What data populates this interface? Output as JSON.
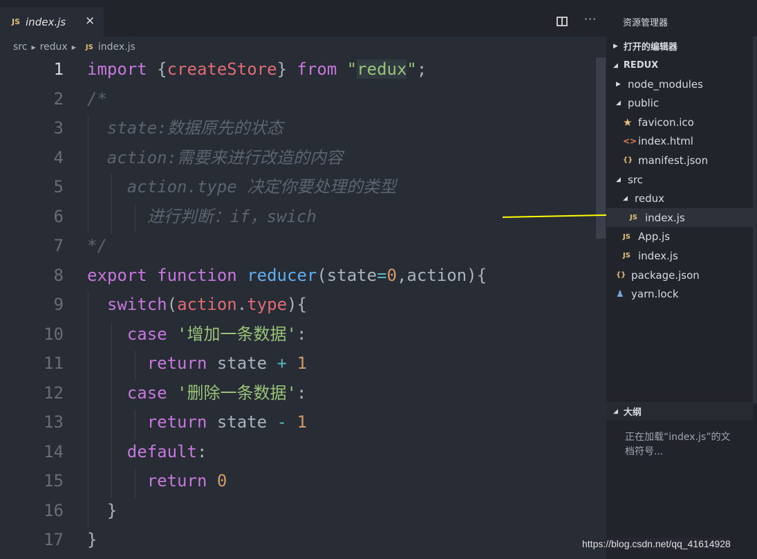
{
  "tab": {
    "icon_text": "JS",
    "label": "index.js",
    "close": "×"
  },
  "toolbar": {
    "more": "···"
  },
  "breadcrumb": {
    "parts": [
      "src",
      "redux"
    ],
    "file_icon": "JS",
    "file": "index.js"
  },
  "editor": {
    "line_numbers": [
      "1",
      "2",
      "3",
      "4",
      "5",
      "6",
      "7",
      "8",
      "9",
      "10",
      "11",
      "12",
      "13",
      "14",
      "15",
      "16",
      "17"
    ],
    "active_line": 1,
    "lines": [
      [
        {
          "t": "import",
          "c": "kw"
        },
        {
          "t": " ",
          "c": ""
        },
        {
          "t": "{",
          "c": ""
        },
        {
          "t": "createStore",
          "c": "red"
        },
        {
          "t": "}",
          "c": ""
        },
        {
          "t": " ",
          "c": ""
        },
        {
          "t": "from",
          "c": "kw"
        },
        {
          "t": " ",
          "c": ""
        },
        {
          "t": "\"",
          "c": "str"
        },
        {
          "t": "redux",
          "c": "str strhl"
        },
        {
          "t": "\"",
          "c": "str"
        },
        {
          "t": ";",
          "c": ""
        }
      ],
      [
        {
          "t": "/*",
          "c": "cm"
        }
      ],
      [
        {
          "t": "  state:数据原先的状态",
          "c": "cm"
        }
      ],
      [
        {
          "t": "  action:需要来进行改造的内容",
          "c": "cm"
        }
      ],
      [
        {
          "t": "    action.type 决定你要处理的类型",
          "c": "cm"
        }
      ],
      [
        {
          "t": "      进行判断：if，swich",
          "c": "cm"
        }
      ],
      [
        {
          "t": "*/",
          "c": "cm"
        }
      ],
      [
        {
          "t": "export",
          "c": "kw"
        },
        {
          "t": " ",
          "c": ""
        },
        {
          "t": "function",
          "c": "kw"
        },
        {
          "t": " ",
          "c": ""
        },
        {
          "t": "reducer",
          "c": "fn"
        },
        {
          "t": "(state",
          "c": ""
        },
        {
          "t": "=",
          "c": "op"
        },
        {
          "t": "0",
          "c": "num"
        },
        {
          "t": ",action){",
          "c": ""
        }
      ],
      [
        {
          "t": "  ",
          "c": ""
        },
        {
          "t": "switch",
          "c": "kw"
        },
        {
          "t": "(",
          "c": ""
        },
        {
          "t": "action",
          "c": "red"
        },
        {
          "t": ".",
          "c": ""
        },
        {
          "t": "type",
          "c": "red"
        },
        {
          "t": "){",
          "c": ""
        }
      ],
      [
        {
          "t": "    ",
          "c": ""
        },
        {
          "t": "case",
          "c": "kw"
        },
        {
          "t": " ",
          "c": ""
        },
        {
          "t": "'增加一条数据'",
          "c": "str"
        },
        {
          "t": ":",
          "c": ""
        }
      ],
      [
        {
          "t": "      ",
          "c": ""
        },
        {
          "t": "return",
          "c": "kw"
        },
        {
          "t": " state ",
          "c": ""
        },
        {
          "t": "+",
          "c": "op"
        },
        {
          "t": " ",
          "c": ""
        },
        {
          "t": "1",
          "c": "num"
        }
      ],
      [
        {
          "t": "    ",
          "c": ""
        },
        {
          "t": "case",
          "c": "kw"
        },
        {
          "t": " ",
          "c": ""
        },
        {
          "t": "'删除一条数据'",
          "c": "str"
        },
        {
          "t": ":",
          "c": ""
        }
      ],
      [
        {
          "t": "      ",
          "c": ""
        },
        {
          "t": "return",
          "c": "kw"
        },
        {
          "t": " state ",
          "c": ""
        },
        {
          "t": "-",
          "c": "op"
        },
        {
          "t": " ",
          "c": ""
        },
        {
          "t": "1",
          "c": "num"
        }
      ],
      [
        {
          "t": "    ",
          "c": ""
        },
        {
          "t": "default",
          "c": "kw"
        },
        {
          "t": ":",
          "c": ""
        }
      ],
      [
        {
          "t": "      ",
          "c": ""
        },
        {
          "t": "return",
          "c": "kw"
        },
        {
          "t": " ",
          "c": ""
        },
        {
          "t": "0",
          "c": "num"
        }
      ],
      [
        {
          "t": "  }",
          "c": ""
        }
      ],
      [
        {
          "t": "}",
          "c": ""
        }
      ]
    ]
  },
  "sidebar": {
    "title": "资源管理器",
    "open_editors": "打开的编辑器",
    "project": "REDUX",
    "outline": "大纲",
    "outline_message": "正在加载“index.js”的文档符号...",
    "tree": [
      {
        "label": "node_modules",
        "icon": "",
        "icon_type": "folder",
        "state": "collapsed"
      },
      {
        "label": "public",
        "icon": "",
        "icon_type": "folder",
        "state": "expanded"
      },
      {
        "label": "favicon.ico",
        "icon": "★",
        "icon_type": "star"
      },
      {
        "label": "index.html",
        "icon": "<>",
        "icon_type": "html"
      },
      {
        "label": "manifest.json",
        "icon": "{}",
        "icon_type": "json"
      },
      {
        "label": "src",
        "icon": "",
        "icon_type": "folder",
        "state": "expanded"
      },
      {
        "label": "redux",
        "icon": "",
        "icon_type": "folder",
        "state": "expanded"
      },
      {
        "label": "index.js",
        "icon": "JS",
        "icon_type": "js",
        "selected": true
      },
      {
        "label": "App.js",
        "icon": "JS",
        "icon_type": "js"
      },
      {
        "label": "index.js",
        "icon": "JS",
        "icon_type": "js"
      },
      {
        "label": "package.json",
        "icon": "{}",
        "icon_type": "json"
      },
      {
        "label": "yarn.lock",
        "icon": "♟",
        "icon_type": "yarn"
      }
    ]
  },
  "watermark": "https://blog.csdn.net/qq_41614928",
  "colors": {
    "editor_bg": "#282c34",
    "sidebar_bg": "#21252b",
    "keyword": "#c678dd",
    "string": "#98c379",
    "function": "#61afef",
    "number": "#d19a66",
    "arrow": "#ffff00"
  }
}
